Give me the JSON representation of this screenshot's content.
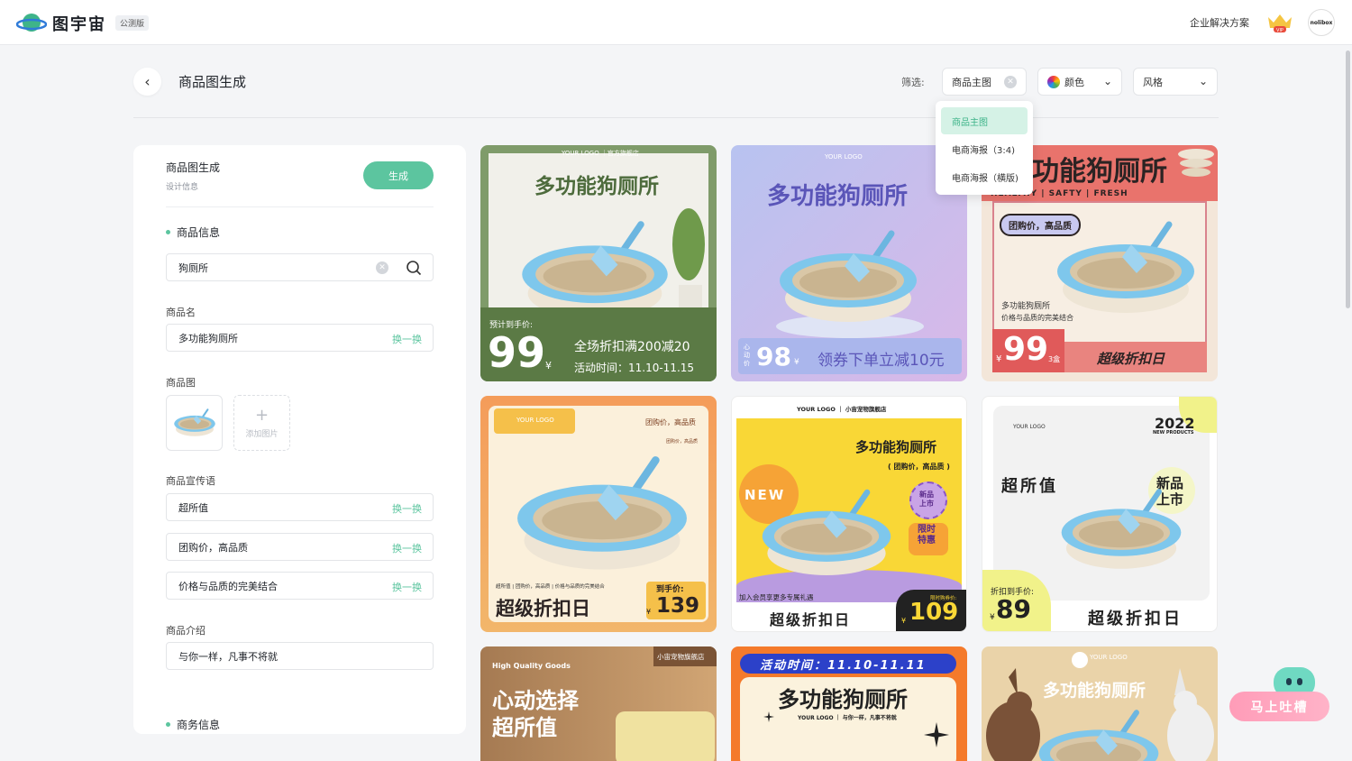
{
  "topbar": {
    "brand": "图宇宙",
    "beta": "公测版",
    "enterprise": "企业解决方案",
    "vip": "VIP",
    "avatar_text": "nolibox"
  },
  "header": {
    "title": "商品图生成",
    "filter_label": "筛选:",
    "filter_type_value": "商品主图",
    "filter_color": "颜色",
    "filter_style": "风格"
  },
  "dropdown": {
    "items": [
      "商品主图",
      "电商海报（3:4)",
      "电商海报（横版)"
    ]
  },
  "panel": {
    "title": "商品图生成",
    "subtitle": "设计信息",
    "generate": "生成",
    "section_product": "商品信息",
    "search_value": "狗厕所",
    "name_label": "商品名",
    "name_value": "多功能狗厕所",
    "swap": "换一换",
    "image_label": "商品图",
    "add_image": "添加图片",
    "slogan_label": "商品宣传语",
    "slogans": [
      "超所值",
      "团购价，高品质",
      "价格与品质的完美结合"
    ],
    "intro_label": "商品介绍",
    "intro_value": "与你一样，凡事不将就",
    "section_business": "商务信息"
  },
  "cards": {
    "c1": {
      "logo": "YOUR LOGO ｜官方旗舰店",
      "title": "多功能狗厕所",
      "pre": "预计到手价:",
      "price": "99",
      "yen": "¥",
      "line1": "全场折扣满200减20",
      "line2": "活动时间：11.10-11.15"
    },
    "c2": {
      "logo": "YOUR LOGO",
      "title": "多功能狗厕所",
      "tag": "心动价",
      "price": "98",
      "yen": "¥",
      "slogan": "领券下单立减10元"
    },
    "c3": {
      "title": "功能狗厕所",
      "sub": "HEALTHY | SAFTY | FRESH",
      "badge": "团购价，高品质",
      "name": "多功能狗厕所",
      "desc": "价格与品质的完美结合",
      "yen": "¥",
      "price": "99",
      "unit": "3盒",
      "banner": "超级折扣日"
    },
    "c4": {
      "logo": "YOUR LOGO",
      "tag1": "团购价，高品质",
      "tag2": "团购价，高品质",
      "small": "超所值 | 团购价，高品质 | 价格与品质的完美结合",
      "banner": "超级折扣日",
      "pre": "到手价:",
      "yen": "¥",
      "price": "139"
    },
    "c5": {
      "logo": "YOUR LOGO ｜ 小宙宠物旗舰店",
      "title": "多功能狗厕所",
      "sub": "( 团购价，高品质 )",
      "new": "NEW",
      "badge1": "新品上市",
      "badge2": "限时特惠",
      "member": "加入会员享更多专属礼遇",
      "banner": "超级折扣日",
      "pre": "限时购券价:",
      "yen": "¥",
      "price": "109"
    },
    "c6": {
      "logo": "YOUR LOGO",
      "year": "2022",
      "yearsub": "NEW PRODUCTS",
      "title": "超所值",
      "badge": "新品上市",
      "pre": "折扣到手价:",
      "yen": "¥",
      "price": "89",
      "banner": "超级折扣日"
    },
    "c7": {
      "tag": "High Quality Goods",
      "shop": "小宙宠物旗舰店",
      "line1": "心动选择",
      "line2": "超所值"
    },
    "c8": {
      "time": "活动时间：11.10-11.11",
      "title": "多功能狗厕所",
      "logo": "YOUR LOGO ｜ 与你一样，凡事不将就"
    },
    "c9": {
      "logo": "YOUR LOGO",
      "title": "多功能狗厕所"
    }
  },
  "feedback": {
    "label": "马上吐槽"
  }
}
